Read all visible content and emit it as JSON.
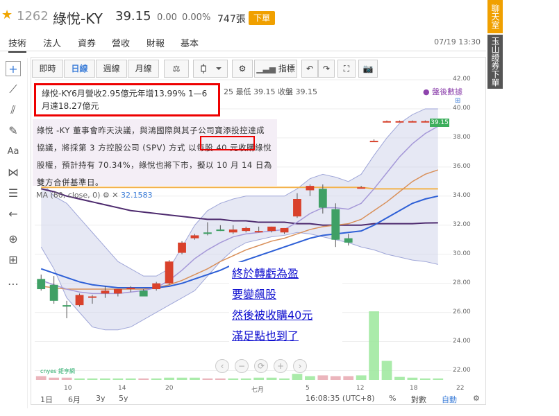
{
  "quote": {
    "code": "1262",
    "name": "綠悅-KY",
    "price": "39.15",
    "change": "0.00",
    "change_pct": "0.00%",
    "volume": "747張",
    "order_label": "下單"
  },
  "tabs": [
    "技術",
    "法人",
    "資券",
    "營收",
    "財報",
    "基本"
  ],
  "datetime": "07/19 13:30",
  "side_buttons": [
    "聊天室",
    "玉山證券下單"
  ],
  "toolbar": {
    "buttons": [
      "即時",
      "日線",
      "週線",
      "月線",
      "⚖",
      "",
      "⚙",
      "指標",
      "↶",
      "↷",
      "⛶",
      "📷"
    ]
  },
  "ohlc_text": "25  最低  39.15  收盤  39.15",
  "news": {
    "headline": "綠悅-KY6月營收2.95億元年增13.99% 1—6月達18.27億元",
    "body": "綠悅 -KY 董事會昨天決議，與鴻國際與其子公司寶添投控達成協議，將採第 3 方控股公司 (SPV) 方式 以每股 40 元收購綠悅股權，預計持有 70.34%，綠悅也將下市，擬以 10 月 14 日為雙方合併基準日。"
  },
  "ma_label": "MA (60, close, 0)",
  "ma_value": "32.1583",
  "after_hours_label": "盤後數據",
  "note": [
    "終於轉虧為盈",
    "要變飆股",
    "然後被收購40元",
    "滿足點也到了"
  ],
  "price_tag": "39.15",
  "y_ticks": [
    "42.00",
    "40.00",
    "38.00",
    "36.00",
    "34.00",
    "32.00",
    "30.00",
    "28.00",
    "26.00",
    "24.00",
    "22.00"
  ],
  "x_ticks": [
    "10",
    "14",
    "20",
    "七月",
    "5",
    "12",
    "18",
    "22"
  ],
  "x_month_label": "6月",
  "bottombar": {
    "ranges": [
      "1日",
      "6月",
      "3y",
      "5y"
    ],
    "time": "16:08:35 (UTC+8)",
    "pct": "%",
    "log": "對數",
    "auto": "自動"
  },
  "logo_text": "cnyes 鉅亨網",
  "chart_data": {
    "type": "candlestick",
    "ylim": [
      21.5,
      42
    ],
    "candles": [
      {
        "o": 28.3,
        "h": 28.6,
        "l": 27.5,
        "c": 27.6
      },
      {
        "o": 27.9,
        "h": 28.5,
        "l": 26.6,
        "c": 26.8
      },
      {
        "o": 26.5,
        "h": 26.8,
        "l": 25.6,
        "c": 26.4
      },
      {
        "o": 26.5,
        "h": 27.3,
        "l": 26.4,
        "c": 27.2
      },
      {
        "o": 27.1,
        "h": 27.2,
        "l": 26.6,
        "c": 27.1
      },
      {
        "o": 27.3,
        "h": 27.8,
        "l": 27.0,
        "c": 27.5
      },
      {
        "o": 27.3,
        "h": 27.6,
        "l": 27.1,
        "c": 27.6
      },
      {
        "o": 27.6,
        "h": 27.8,
        "l": 27.4,
        "c": 27.7
      },
      {
        "o": 27.5,
        "h": 27.6,
        "l": 27.2,
        "c": 27.1
      },
      {
        "o": 27.6,
        "h": 28.1,
        "l": 27.5,
        "c": 28.0
      },
      {
        "o": 28.0,
        "h": 29.6,
        "l": 27.9,
        "c": 29.5
      },
      {
        "o": 30.1,
        "h": 30.9,
        "l": 30.0,
        "c": 30.8
      },
      {
        "o": 31.1,
        "h": 31.4,
        "l": 31.0,
        "c": 31.3
      },
      {
        "o": 31.5,
        "h": 32.2,
        "l": 31.3,
        "c": 31.4
      },
      {
        "o": 31.7,
        "h": 32.0,
        "l": 31.6,
        "c": 31.6
      },
      {
        "o": 31.5,
        "h": 32.0,
        "l": 31.4,
        "c": 31.7
      },
      {
        "o": 31.6,
        "h": 31.9,
        "l": 31.5,
        "c": 31.8
      },
      {
        "o": 31.6,
        "h": 31.9,
        "l": 31.5,
        "c": 31.6
      },
      {
        "o": 31.6,
        "h": 31.9,
        "l": 31.5,
        "c": 31.9
      },
      {
        "o": 31.5,
        "h": 31.8,
        "l": 31.4,
        "c": 31.8
      },
      {
        "o": 32.6,
        "h": 34.2,
        "l": 32.5,
        "c": 33.8
      },
      {
        "o": 34.4,
        "h": 34.8,
        "l": 34.0,
        "c": 34.7
      },
      {
        "o": 34.5,
        "h": 34.8,
        "l": 32.8,
        "c": 33.2
      },
      {
        "o": 33.1,
        "h": 33.5,
        "l": 30.5,
        "c": 31.0
      },
      {
        "o": 31.1,
        "h": 31.4,
        "l": 30.6,
        "c": 30.8
      },
      {
        "o": 34.6,
        "h": 34.7,
        "l": 34.6,
        "c": 34.6
      },
      {
        "o": 37.8,
        "h": 37.9,
        "l": 37.8,
        "c": 37.8
      },
      {
        "o": 39.1,
        "h": 39.2,
        "l": 39.1,
        "c": 39.15
      },
      {
        "o": 39.1,
        "h": 39.2,
        "l": 39.1,
        "c": 39.15
      },
      {
        "o": 39.1,
        "h": 39.2,
        "l": 39.1,
        "c": 39.15
      },
      {
        "o": 39.1,
        "h": 39.2,
        "l": 39.1,
        "c": 39.15
      },
      {
        "o": 39.1,
        "h": 39.2,
        "l": 39.1,
        "c": 39.15
      }
    ],
    "volume_levels": [
      0.05,
      0.03,
      0.03,
      0.02,
      0.02,
      0.02,
      0.02,
      0.02,
      0.02,
      0.02,
      0.03,
      0.03,
      0.03,
      0.02,
      0.02,
      0.02,
      0.02,
      0.03,
      0.03,
      0.02,
      0.08,
      0.05,
      0.06,
      0.05,
      0.05,
      0.06,
      0.9,
      0.25,
      0.04,
      0.03,
      0.02,
      0.02
    ],
    "ma_series": {
      "purple_ma": [
        34.5,
        34.3,
        34.0,
        33.8,
        33.6,
        33.4,
        33.2,
        33.0,
        32.9,
        32.8,
        32.7,
        32.6,
        32.5,
        32.4,
        32.4,
        32.3,
        32.3,
        32.2,
        32.2,
        32.2,
        32.1,
        32.1,
        32.0,
        32.0,
        32.0,
        32.0,
        32.1,
        32.1,
        32.1,
        32.1,
        32.15,
        32.16
      ],
      "orange_ma": [
        34.6,
        34.6,
        34.6,
        34.6,
        34.6,
        34.6,
        34.6,
        34.6,
        34.6,
        34.6,
        34.6,
        34.6,
        34.6,
        34.6,
        34.6,
        34.6,
        34.6,
        34.6,
        34.6,
        34.6,
        34.6,
        34.6,
        34.6,
        34.6,
        34.6,
        34.6,
        34.5,
        34.5,
        34.5,
        34.5,
        34.5,
        34.5
      ],
      "blue_ma": [
        29.0,
        28.7,
        28.4,
        28.1,
        27.9,
        27.8,
        27.7,
        27.7,
        27.7,
        27.7,
        27.8,
        28.0,
        28.3,
        28.6,
        28.9,
        29.3,
        29.6,
        29.9,
        30.2,
        30.5,
        30.8,
        31.1,
        31.3,
        31.4,
        31.5,
        31.6,
        32.0,
        32.5,
        33.0,
        33.5,
        33.8,
        34.0
      ],
      "brown_ma": [
        27.8,
        27.7,
        27.6,
        27.6,
        27.6,
        27.6,
        27.6,
        27.6,
        27.6,
        27.7,
        27.9,
        28.2,
        28.6,
        29.0,
        29.5,
        29.9,
        30.3,
        30.6,
        30.9,
        31.1,
        31.4,
        31.7,
        31.9,
        32.0,
        32.1,
        32.4,
        33.0,
        33.6,
        34.3,
        35.0,
        35.5,
        35.8
      ],
      "lavender_ma": [
        28.2,
        27.9,
        27.6,
        27.4,
        27.3,
        27.3,
        27.3,
        27.4,
        27.5,
        27.7,
        28.2,
        28.9,
        29.7,
        30.3,
        30.8,
        31.2,
        31.4,
        31.5,
        31.6,
        31.7,
        32.2,
        32.8,
        33.2,
        33.2,
        33.1,
        33.5,
        34.5,
        35.6,
        36.7,
        37.6,
        38.3,
        38.8
      ],
      "band_upper": [
        35.0,
        34.0,
        33.5,
        32.5,
        31.5,
        30.5,
        29.5,
        29.0,
        28.5,
        28.5,
        29.0,
        30.5,
        32.0,
        33.0,
        33.5,
        33.8,
        34.0,
        34.0,
        34.0,
        34.0,
        34.5,
        35.2,
        35.5,
        35.3,
        35.0,
        35.5,
        36.8,
        38.0,
        39.0,
        39.6,
        40.0,
        40.0
      ],
      "band_lower": [
        30.5,
        29.0,
        27.0,
        26.0,
        25.0,
        24.8,
        24.8,
        25.0,
        25.5,
        26.0,
        26.5,
        27.0,
        27.5,
        28.5,
        29.5,
        30.3,
        30.8,
        31.0,
        31.2,
        31.3,
        31.5,
        31.4,
        31.2,
        31.0,
        30.8,
        30.5,
        30.3,
        30.0,
        29.8,
        29.6,
        29.5,
        29.3
      ]
    }
  }
}
